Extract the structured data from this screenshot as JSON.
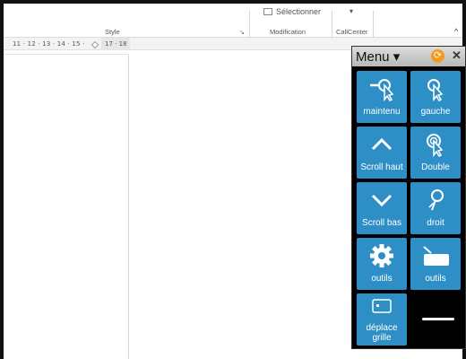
{
  "ribbon": {
    "top_command": "Sélectionner",
    "dropdown_arrow": "▾",
    "groups": {
      "style": "Style",
      "modification": "Modification",
      "callcenter": "CallCenter"
    },
    "launcher_icon": "↘",
    "collapse_icon": "^"
  },
  "ruler": {
    "text": "11 · 12 · 13 · 14 · 15 ·",
    "tail": "17 · 18"
  },
  "menu": {
    "title": "Menu ▾",
    "refresh_icon": "⟳",
    "close_icon": "✕",
    "tiles": [
      {
        "label": "maintenu",
        "icon": "click-hold-icon"
      },
      {
        "label": "gauche",
        "icon": "left-click-icon"
      },
      {
        "label": "Scroll haut",
        "icon": "chevron-up-icon"
      },
      {
        "label": "Double",
        "icon": "double-click-icon"
      },
      {
        "label": "Scroll bas",
        "icon": "chevron-down-icon"
      },
      {
        "label": "droit",
        "icon": "right-click-icon"
      },
      {
        "label": "outils",
        "icon": "gear-icon"
      },
      {
        "label": "outils",
        "icon": "keyboard-tool-icon"
      },
      {
        "label": "déplace grille",
        "icon": "grid-move-icon"
      }
    ],
    "accent_color": "#2d8fc6",
    "refresh_color": "#f29a1c"
  }
}
